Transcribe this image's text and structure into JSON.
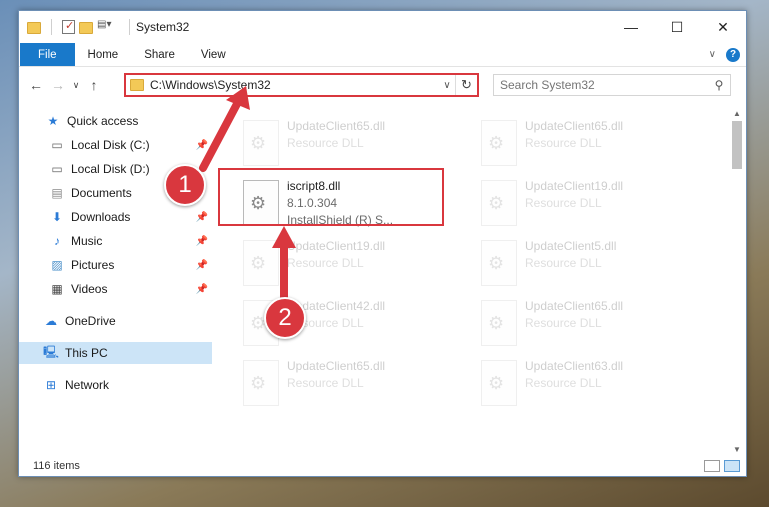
{
  "window": {
    "title": "System32",
    "controls": [
      "—",
      "☐",
      "✕"
    ]
  },
  "ribbon": {
    "tabs": [
      "File",
      "Home",
      "Share",
      "View"
    ],
    "help": "?"
  },
  "address": {
    "path": "C:\\Windows\\System32",
    "search_placeholder": "Search System32"
  },
  "sidebar": {
    "items": [
      {
        "label": "Quick access",
        "icon": "star-icon"
      },
      {
        "label": "Local Disk (C:)",
        "icon": "drive-icon"
      },
      {
        "label": "Local Disk (D:)",
        "icon": "drive-icon"
      },
      {
        "label": "Documents",
        "icon": "documents-icon"
      },
      {
        "label": "Downloads",
        "icon": "download-icon"
      },
      {
        "label": "Music",
        "icon": "music-icon"
      },
      {
        "label": "Pictures",
        "icon": "pictures-icon"
      },
      {
        "label": "Videos",
        "icon": "videos-icon"
      },
      {
        "label": "OneDrive",
        "icon": "cloud-icon"
      },
      {
        "label": "This PC",
        "icon": "computer-icon"
      },
      {
        "label": "Network",
        "icon": "network-icon"
      }
    ]
  },
  "files": {
    "highlighted": {
      "name": "iscript8.dll",
      "version": "8.1.0.304",
      "company": "InstallShield (R) S..."
    },
    "tiles": [
      {
        "name": "UpdateClient65.dll",
        "type": "Resource DLL"
      },
      {
        "name": "UpdateClient65.dll",
        "type": "Resource DLL"
      },
      {
        "name": "UpdateClient19.dll",
        "type": "Resource DLL"
      },
      {
        "name": "UpdateClient19.dll",
        "type": "Resource DLL"
      },
      {
        "name": "UpdateClient5.dll",
        "type": "Resource DLL"
      },
      {
        "name": "UpdateClient42.dll",
        "type": "Resource DLL"
      },
      {
        "name": "UpdateClient65.dll",
        "type": "Resource DLL"
      },
      {
        "name": "UpdateClient65.dll",
        "type": "Resource DLL"
      },
      {
        "name": "UpdateClient63.dll",
        "type": "Resource DLL"
      }
    ]
  },
  "status": {
    "count": "116 items"
  },
  "callouts": [
    "1",
    "2"
  ],
  "colors": {
    "accent": "#1979ca",
    "highlight": "#d9373e",
    "selected": "#cce4f7"
  }
}
